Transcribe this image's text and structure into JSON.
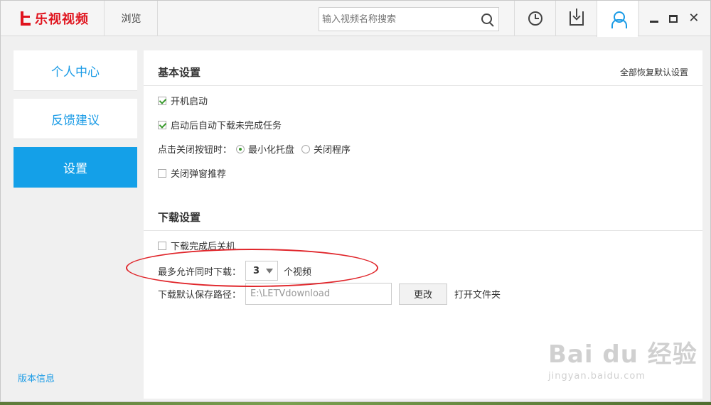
{
  "app": {
    "logo_text": "乐视视频",
    "nav_browse": "浏览"
  },
  "search": {
    "placeholder": "输入视频名称搜索"
  },
  "sidebar": {
    "items": [
      {
        "label": "个人中心"
      },
      {
        "label": "反馈建议"
      },
      {
        "label": "设置"
      }
    ],
    "version_link": "版本信息"
  },
  "settings": {
    "basic": {
      "title": "基本设置",
      "reset_all": "全部恢复默认设置",
      "boot_start": {
        "label": "开机启动",
        "checked": true
      },
      "auto_download": {
        "label": "启动后自动下载未完成任务",
        "checked": true
      },
      "close_action": {
        "label": "点击关闭按钮时：",
        "options": [
          "最小化托盘",
          "关闭程序"
        ],
        "selected": "最小化托盘"
      },
      "close_popup": {
        "label": "关闭弹窗推荐",
        "checked": false
      }
    },
    "download": {
      "title": "下载设置",
      "shutdown_after": {
        "label": "下载完成后关机",
        "checked": false
      },
      "max_simultaneous": {
        "label": "最多允许同时下载：",
        "value": "3",
        "suffix": "个视频"
      },
      "path": {
        "label": "下载默认保存路径：",
        "value": "E:\\LETVdownload",
        "change_button": "更改",
        "open_folder": "打开文件夹"
      }
    }
  },
  "watermark": {
    "big": "Bai du 经验",
    "small": "jingyan.baidu.com"
  },
  "colors": {
    "brand_red": "#e0141e",
    "accent_blue": "#14a0e8",
    "check_green": "#3a9a2e",
    "annotation_red": "#e0262b"
  }
}
